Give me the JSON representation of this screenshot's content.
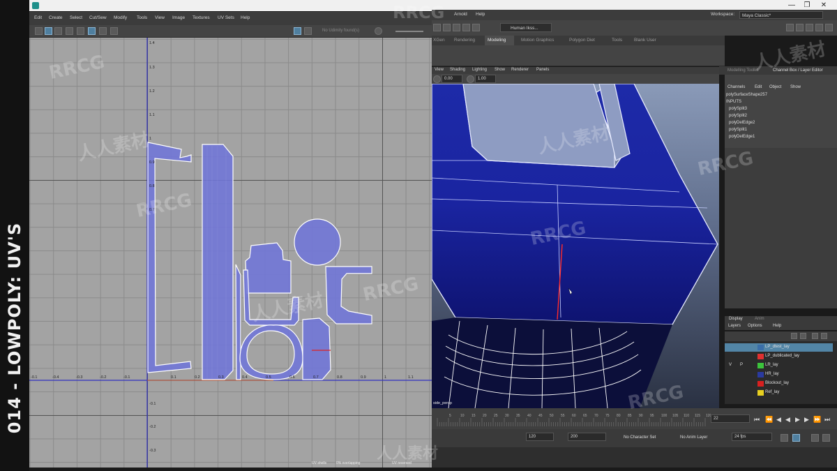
{
  "side_title": "014 - LOWPOLY: UV'S",
  "window_controls": [
    "—",
    "❐",
    "✕"
  ],
  "uv_editor": {
    "menus": [
      "Edit",
      "Create",
      "Select",
      "Cut/Sew",
      "Modify",
      "Tools",
      "View",
      "Image",
      "Textures",
      "UV Sets",
      "Help"
    ],
    "texture_dropdown": "No Udimity found(s)",
    "axis_labels_h": [
      "-0.1",
      "-0.4",
      "-0.3",
      "-0.2",
      "-0.1",
      "0.1",
      "0.2",
      "0.3",
      "0.4",
      "0.5",
      "0.6",
      "0.7",
      "0.8",
      "0.9",
      "1",
      "1.1"
    ],
    "axis_labels_v": [
      "1.4",
      "1.3",
      "1.2",
      "1.1",
      "1",
      "0.9",
      "0.8",
      "0.7",
      "-0.1",
      "-0.2",
      "-0.3"
    ],
    "status": [
      "UV shells",
      "0% overlapping",
      "UV reversed"
    ]
  },
  "main": {
    "menus": [
      "Arnold",
      "Help"
    ],
    "workspace_label": "Workspace:",
    "workspace_value": "Maya Classic*",
    "shelf_dropdown": "Human Ikss...",
    "shelf_tabs": [
      "XGen",
      "Rendering",
      "Modeling",
      "Motion Graphics",
      "Polygon Diet",
      "Tools",
      "Blank User"
    ],
    "active_shelf_tab": "Modeling",
    "viewport_menus": [
      "View",
      "Shading",
      "Lighting",
      "Show",
      "Renderer",
      "Panels"
    ],
    "viewport_values": [
      "0.00",
      "1.00"
    ],
    "camera_label": "side_persp"
  },
  "channel_box": {
    "tabs": [
      "Modelling Toolkit",
      "Channel Box / Layer Editor"
    ],
    "menu": [
      "Channels",
      "Edit",
      "Object",
      "Show"
    ],
    "object": "polySurfaceShape257",
    "inputs_label": "INPUTS",
    "inputs": [
      "polySplit3",
      "polySplit2",
      "polyDelEdge2",
      "polySplit1",
      "polyDelEdge1"
    ]
  },
  "layer_editor": {
    "tabs": [
      "Display",
      "Anim"
    ],
    "menu": [
      "Layers",
      "Options",
      "Help"
    ],
    "layers": [
      {
        "v": "",
        "p": "",
        "name": "LP_dtest_lay",
        "color": "#3a6ea8",
        "selected": true
      },
      {
        "v": "",
        "p": "",
        "name": "LP_dublicated_lay",
        "color": "#e03030",
        "selected": false
      },
      {
        "v": "V",
        "p": "P",
        "name": "LR_lay",
        "color": "#3cc33c",
        "selected": false
      },
      {
        "v": "",
        "p": "",
        "name": "HR_lay",
        "color": "#2a3aa0",
        "selected": false
      },
      {
        "v": "",
        "p": "",
        "name": "Blockout_lay",
        "color": "#d82020",
        "selected": false
      },
      {
        "v": "",
        "p": "",
        "name": "Ref_lay",
        "color": "#e8d020",
        "selected": false
      }
    ]
  },
  "timeline": {
    "ticks": [
      "5",
      "10",
      "15",
      "20",
      "25",
      "30",
      "35",
      "40",
      "45",
      "50",
      "55",
      "60",
      "65",
      "70",
      "75",
      "80",
      "85",
      "90",
      "95",
      "100",
      "105",
      "110",
      "115",
      "120"
    ],
    "current_frame": "22",
    "range_start": "120",
    "range_end": "200",
    "character_set": "No Character Set",
    "anim_layer": "No Anim Layer",
    "fps": "24 fps"
  },
  "watermarks": [
    "RRCG",
    "RRCG",
    "RRCG",
    "RRCG",
    "RRCG",
    "RRCG",
    "RRCG",
    "人人素材",
    "人人素材",
    "人人素材",
    "人人素材",
    "人人素材"
  ]
}
